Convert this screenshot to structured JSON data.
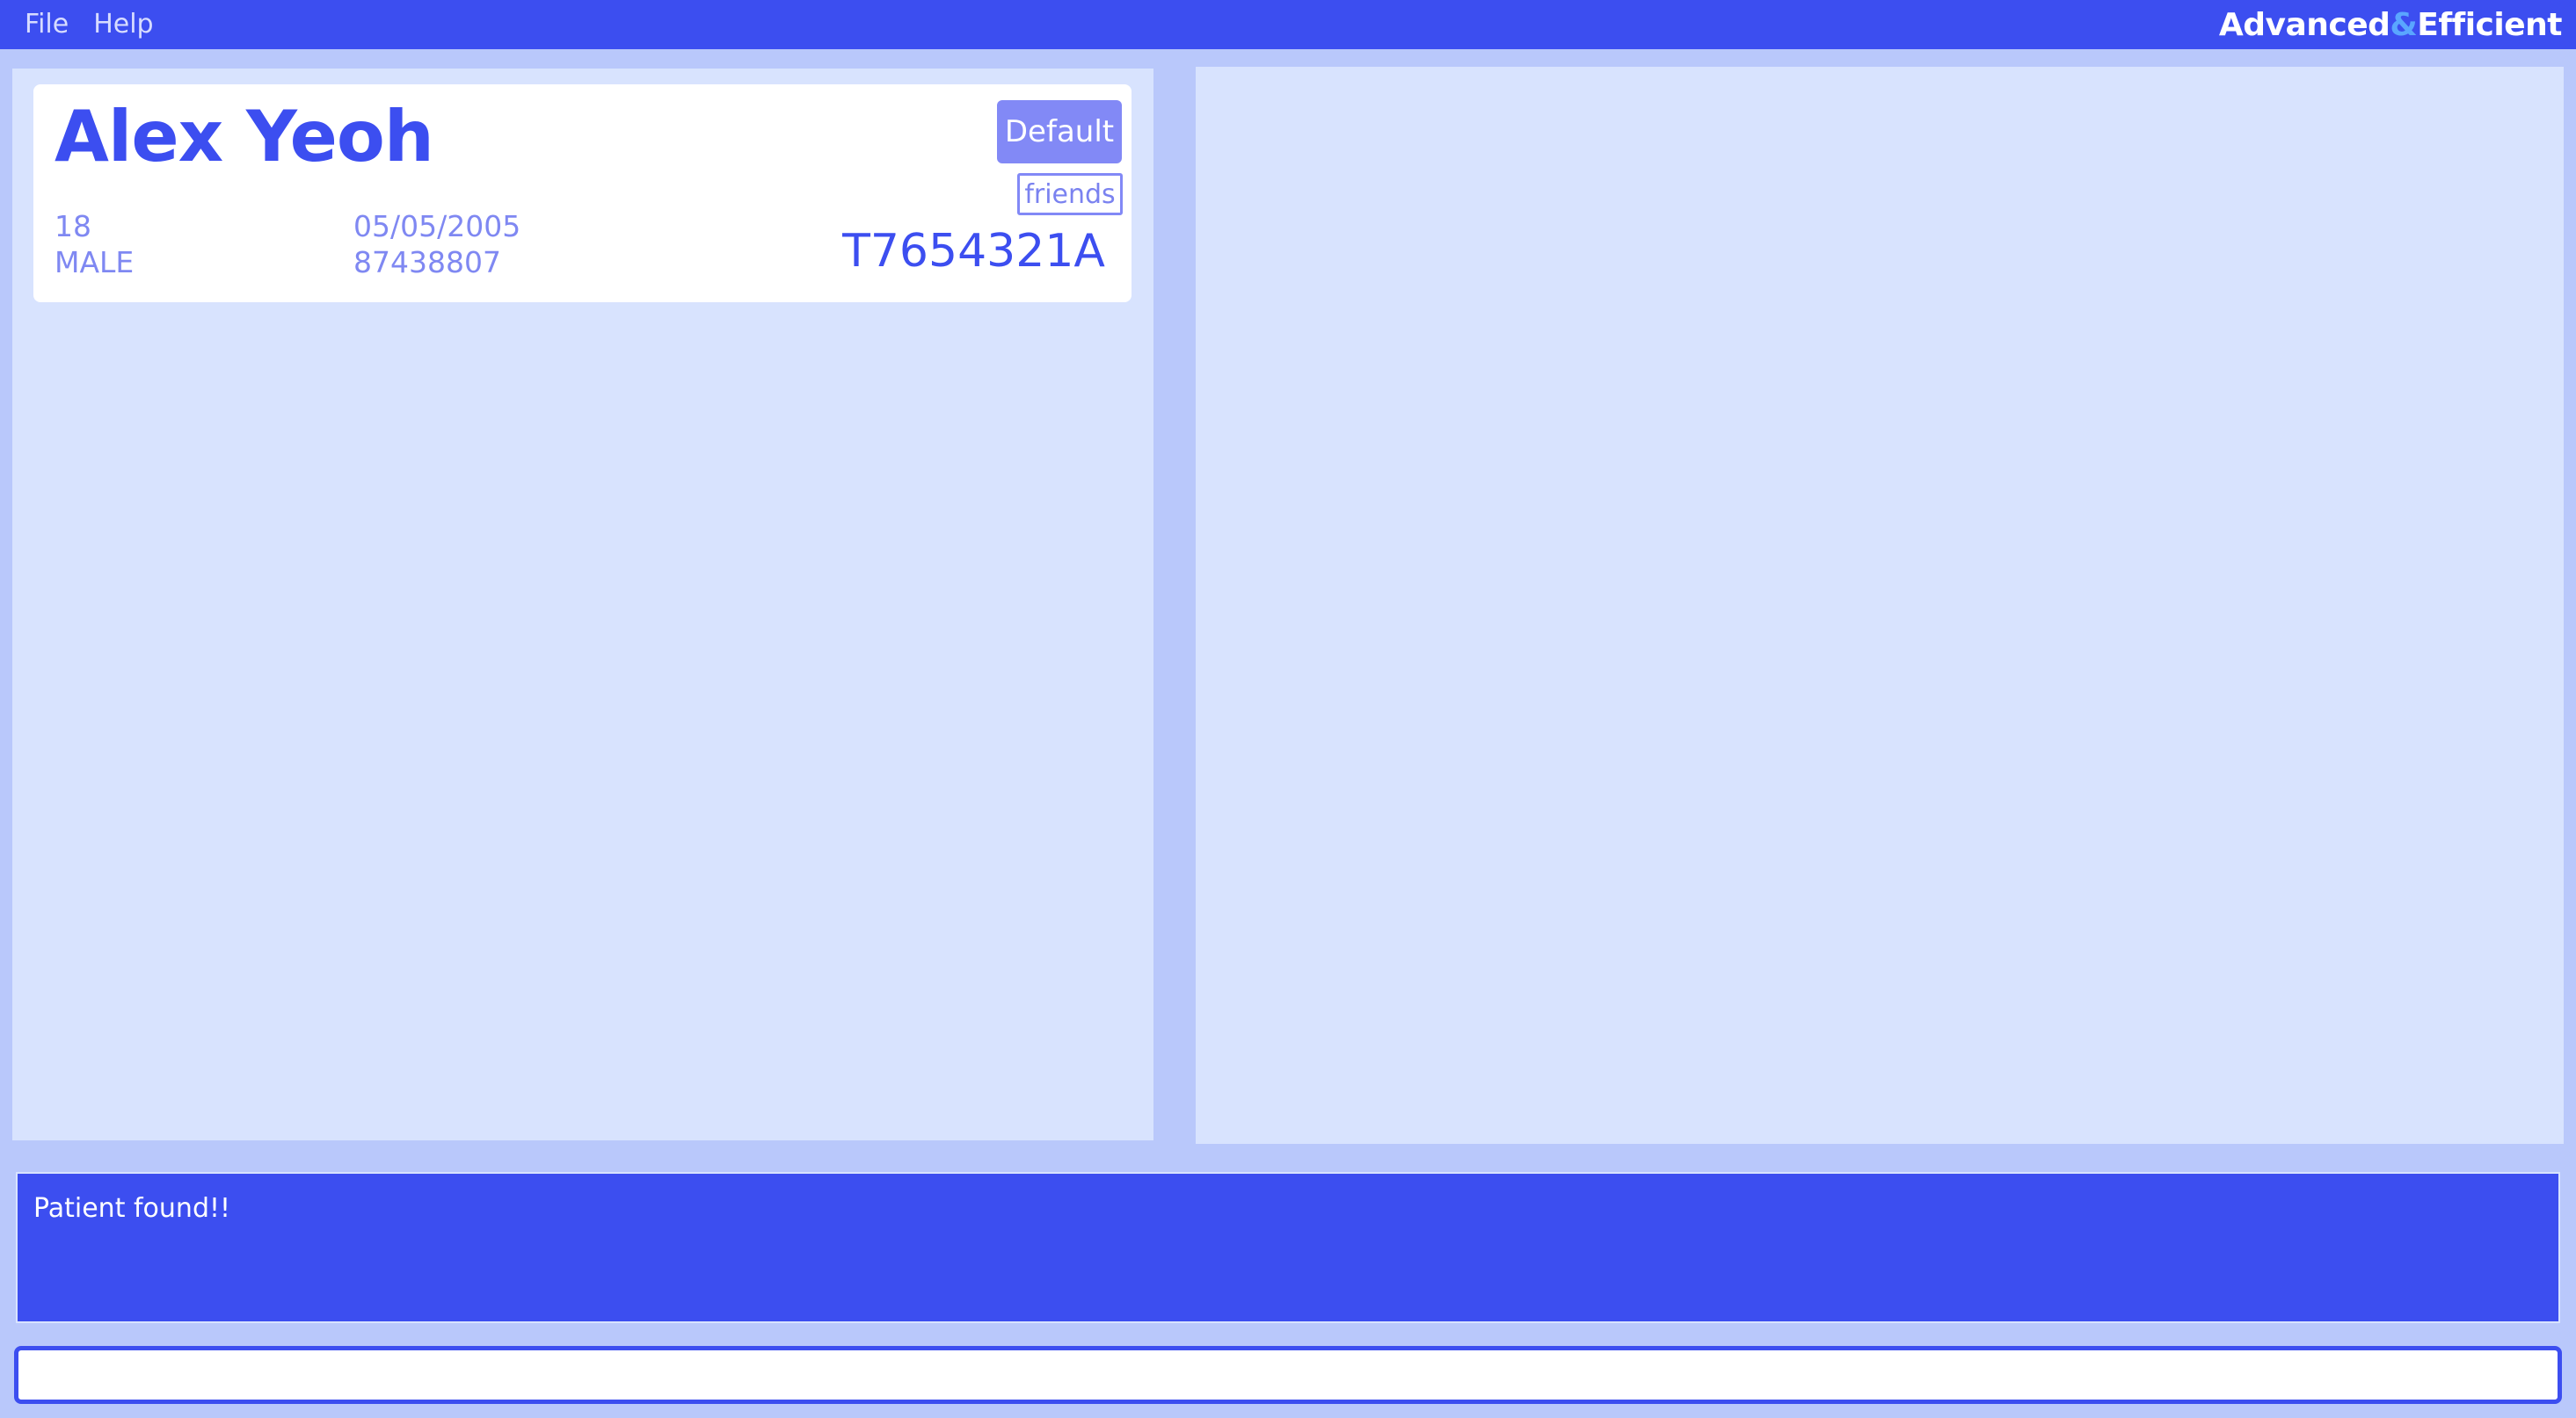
{
  "menu": {
    "items": [
      "File",
      "Help"
    ]
  },
  "brand": {
    "part1": "Advanced",
    "amp": "&",
    "part2": "Efficient"
  },
  "patients": [
    {
      "name": "Alex Yeoh",
      "tags": [
        "Default",
        "friends"
      ],
      "age": "18",
      "sex": "MALE",
      "dob": "05/05/2005",
      "phone": "87438807",
      "nric": "T7654321A"
    }
  ],
  "result": {
    "message": "Patient found!!"
  },
  "command": {
    "value": "",
    "placeholder": ""
  },
  "colors": {
    "accent": "#3c4ef0",
    "background": "#b9c8fb",
    "panel": "#d8e3fe",
    "tag": "#8289f6",
    "brand_amp": "#5aa6ff"
  }
}
